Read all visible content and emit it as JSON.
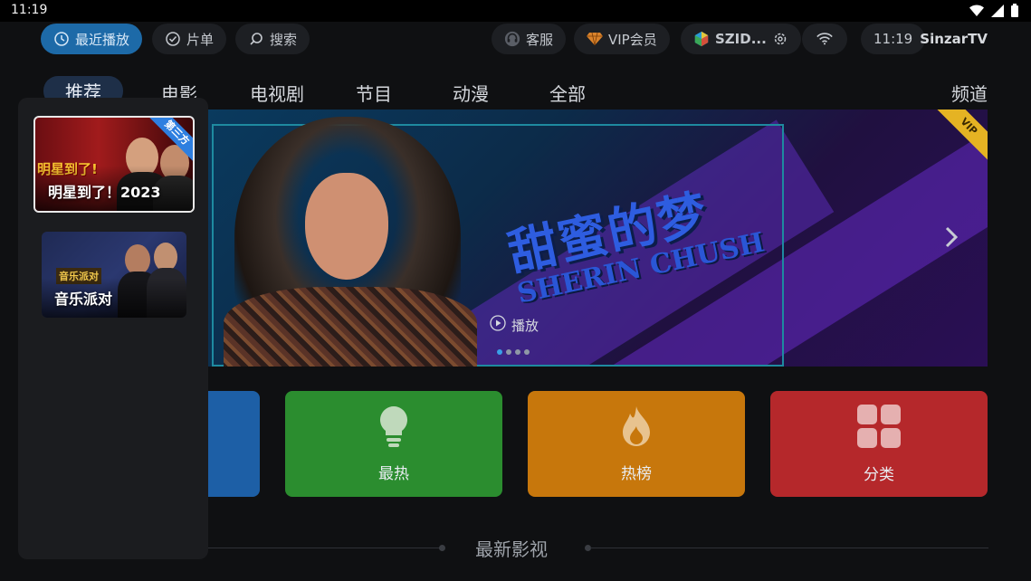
{
  "status_bar": {
    "time": "11:19"
  },
  "top_bar": {
    "recent_label": "最近播放",
    "list_label": "片单",
    "search_label": "搜索",
    "service_label": "客服",
    "vip_label": "VIP会员",
    "account_label": "SZID...",
    "clock": "11:19",
    "brand": "SinzarTV"
  },
  "tabs": [
    {
      "label": "推荐"
    },
    {
      "label": "电影"
    },
    {
      "label": "电视剧"
    },
    {
      "label": "节目"
    },
    {
      "label": "动漫"
    },
    {
      "label": "全部"
    }
  ],
  "channel_label": "频道",
  "banner": {
    "title_cn": "甜蜜的梦",
    "title_en": "SHERIN CHUSH",
    "play_label": "播放",
    "vip_badge": "VIP",
    "page_count": 4,
    "active_page": 1
  },
  "tiles": [
    {
      "label": "",
      "icon": "category-blue-icon",
      "color": "#1d5fa6"
    },
    {
      "label": "最热",
      "icon": "lightbulb-icon",
      "color": "#2b8d2f"
    },
    {
      "label": "热榜",
      "icon": "flame-icon",
      "color": "#c7770c"
    },
    {
      "label": "分类",
      "icon": "grid-icon",
      "color": "#b5282b"
    }
  ],
  "section_title": "最新影视",
  "popup": {
    "items": [
      {
        "title": "明星到了！2023",
        "badge": "第三方",
        "poster_text": "明星到了!"
      },
      {
        "title": "音乐派对",
        "poster_text": "音乐派对"
      }
    ]
  },
  "colors": {
    "accent": "#1d6aa8",
    "background": "#0f1012",
    "vip_gold": "#e5b323"
  }
}
